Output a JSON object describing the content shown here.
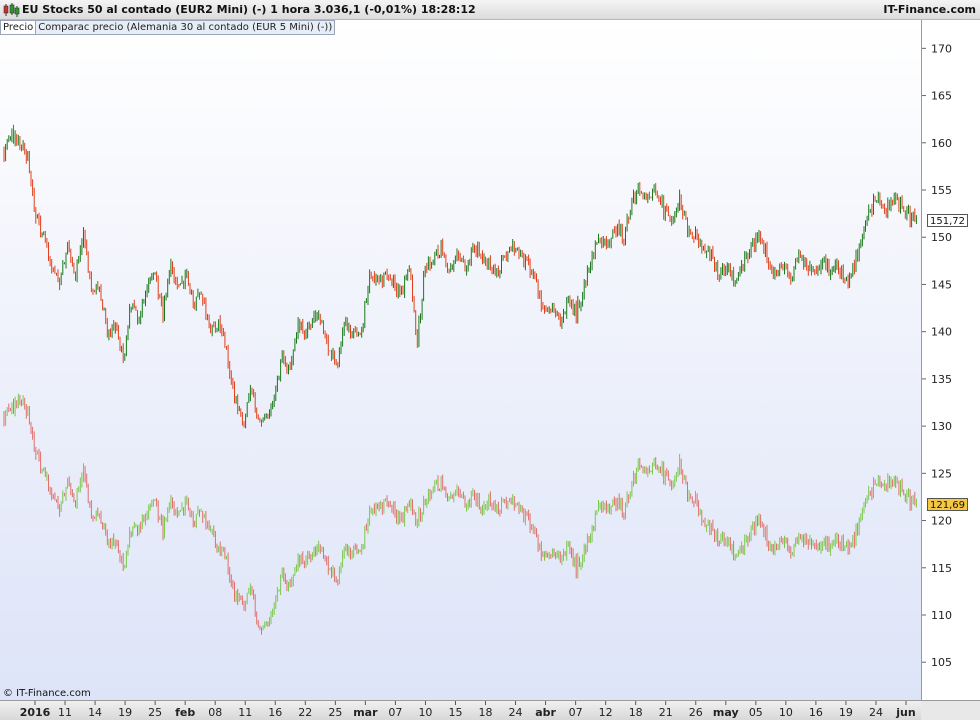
{
  "header": {
    "title": "EU Stocks 50 al contado (EUR2 Mini) (-)   1 hora   3.036,1 (-0,01%)   18:28:12",
    "brand": "IT-Finance.com"
  },
  "tabs": [
    {
      "label": "Precio"
    },
    {
      "label": "Comparac precio (Alemania 30 al contado (EUR 5 Mini) (-))"
    }
  ],
  "footer": {
    "copyright": "© IT-Finance.com"
  },
  "colors": {
    "up": "#1a7a1a",
    "down": "#e0401a",
    "compare_up": "#7cc84a",
    "compare_down": "#e0706a",
    "label_gold": "#f5c842"
  },
  "chart_data": {
    "type": "line",
    "ylim": [
      101,
      173
    ],
    "yticks": [
      105,
      110,
      115,
      120,
      125,
      130,
      135,
      140,
      145,
      150,
      155,
      160,
      165,
      170
    ],
    "xticks": [
      "2016",
      "11",
      "14",
      "19",
      "25",
      "feb",
      "08",
      "11",
      "16",
      "22",
      "25",
      "mar",
      "07",
      "10",
      "15",
      "18",
      "24",
      "abr",
      "07",
      "12",
      "18",
      "21",
      "26",
      "may",
      "05",
      "10",
      "16",
      "19",
      "24",
      "jun"
    ],
    "last_labels": [
      "151,72",
      "121,69"
    ],
    "series": [
      {
        "name": "EU Stocks 50 al contado (EUR2 Mini)",
        "points": [
          [
            0,
            159
          ],
          [
            1,
            161
          ],
          [
            2,
            160
          ],
          [
            3,
            158
          ],
          [
            4,
            152
          ],
          [
            5,
            150
          ],
          [
            6,
            147
          ],
          [
            7,
            145
          ],
          [
            8,
            149
          ],
          [
            9,
            146
          ],
          [
            10,
            150
          ],
          [
            11,
            144
          ],
          [
            12,
            145
          ],
          [
            13,
            140
          ],
          [
            14,
            141
          ],
          [
            15,
            137
          ],
          [
            16,
            143
          ],
          [
            17,
            141
          ],
          [
            18,
            145
          ],
          [
            19,
            146
          ],
          [
            20,
            142
          ],
          [
            21,
            147
          ],
          [
            22,
            145
          ],
          [
            23,
            146
          ],
          [
            24,
            143
          ],
          [
            25,
            144
          ],
          [
            26,
            140
          ],
          [
            27,
            141
          ],
          [
            28,
            138
          ],
          [
            29,
            133
          ],
          [
            30,
            130
          ],
          [
            31,
            134
          ],
          [
            32,
            130
          ],
          [
            33,
            131
          ],
          [
            34,
            133
          ],
          [
            35,
            137
          ],
          [
            36,
            136
          ],
          [
            37,
            141
          ],
          [
            38,
            140
          ],
          [
            39,
            142
          ],
          [
            40,
            141
          ],
          [
            41,
            138
          ],
          [
            42,
            137
          ],
          [
            43,
            141
          ],
          [
            44,
            140
          ],
          [
            45,
            140
          ],
          [
            46,
            146
          ],
          [
            47,
            145
          ],
          [
            48,
            146
          ],
          [
            49,
            145
          ],
          [
            50,
            144
          ],
          [
            51,
            147
          ],
          [
            52,
            139
          ],
          [
            53,
            147
          ],
          [
            54,
            148
          ],
          [
            55,
            149
          ],
          [
            56,
            146
          ],
          [
            57,
            148
          ],
          [
            58,
            147
          ],
          [
            59,
            149
          ],
          [
            60,
            148
          ],
          [
            61,
            147
          ],
          [
            62,
            146
          ],
          [
            63,
            148
          ],
          [
            64,
            149
          ],
          [
            65,
            148
          ],
          [
            66,
            147
          ],
          [
            67,
            145
          ],
          [
            68,
            142
          ],
          [
            69,
            142
          ],
          [
            70,
            141
          ],
          [
            71,
            143
          ],
          [
            72,
            142
          ],
          [
            73,
            145
          ],
          [
            74,
            148
          ],
          [
            75,
            150
          ],
          [
            76,
            149
          ],
          [
            77,
            151
          ],
          [
            78,
            150
          ],
          [
            79,
            154
          ],
          [
            80,
            155
          ],
          [
            81,
            154
          ],
          [
            82,
            155
          ],
          [
            83,
            153
          ],
          [
            84,
            152
          ],
          [
            85,
            154
          ],
          [
            86,
            151
          ],
          [
            87,
            150
          ],
          [
            88,
            149
          ],
          [
            89,
            148
          ],
          [
            90,
            146
          ],
          [
            91,
            147
          ],
          [
            92,
            145
          ],
          [
            93,
            147
          ],
          [
            94,
            149
          ],
          [
            95,
            150
          ],
          [
            96,
            148
          ],
          [
            97,
            146
          ],
          [
            98,
            147
          ],
          [
            99,
            146
          ],
          [
            100,
            148
          ],
          [
            101,
            147
          ],
          [
            102,
            146
          ],
          [
            103,
            148
          ],
          [
            104,
            146
          ],
          [
            105,
            147
          ],
          [
            106,
            145
          ],
          [
            107,
            147
          ],
          [
            108,
            150
          ],
          [
            109,
            153
          ],
          [
            110,
            154
          ],
          [
            111,
            153
          ],
          [
            112,
            154
          ],
          [
            113,
            153
          ],
          [
            114,
            152
          ],
          [
            115,
            151.72
          ]
        ]
      },
      {
        "name": "Alemania 30 al contado (EUR 5 Mini)",
        "points": [
          [
            0,
            131
          ],
          [
            1,
            132
          ],
          [
            2,
            133
          ],
          [
            3,
            131
          ],
          [
            4,
            127
          ],
          [
            5,
            125
          ],
          [
            6,
            123
          ],
          [
            7,
            121
          ],
          [
            8,
            124
          ],
          [
            9,
            122
          ],
          [
            10,
            125
          ],
          [
            11,
            120
          ],
          [
            12,
            121
          ],
          [
            13,
            118
          ],
          [
            14,
            118
          ],
          [
            15,
            115
          ],
          [
            16,
            119
          ],
          [
            17,
            119
          ],
          [
            18,
            121
          ],
          [
            19,
            122
          ],
          [
            20,
            119
          ],
          [
            21,
            122
          ],
          [
            22,
            121
          ],
          [
            23,
            122
          ],
          [
            24,
            120
          ],
          [
            25,
            121
          ],
          [
            26,
            119
          ],
          [
            27,
            117
          ],
          [
            28,
            116
          ],
          [
            29,
            112
          ],
          [
            30,
            111
          ],
          [
            31,
            113
          ],
          [
            32,
            108
          ],
          [
            33,
            109
          ],
          [
            34,
            111
          ],
          [
            35,
            114
          ],
          [
            36,
            113
          ],
          [
            37,
            116
          ],
          [
            38,
            116
          ],
          [
            39,
            117
          ],
          [
            40,
            117
          ],
          [
            41,
            115
          ],
          [
            42,
            114
          ],
          [
            43,
            117
          ],
          [
            44,
            117
          ],
          [
            45,
            117
          ],
          [
            46,
            121
          ],
          [
            47,
            121
          ],
          [
            48,
            122
          ],
          [
            49,
            121
          ],
          [
            50,
            120
          ],
          [
            51,
            122
          ],
          [
            52,
            120
          ],
          [
            53,
            122
          ],
          [
            54,
            124
          ],
          [
            55,
            124
          ],
          [
            56,
            122
          ],
          [
            57,
            123
          ],
          [
            58,
            122
          ],
          [
            59,
            123
          ],
          [
            60,
            121
          ],
          [
            61,
            122
          ],
          [
            62,
            121
          ],
          [
            63,
            122
          ],
          [
            64,
            122
          ],
          [
            65,
            121
          ],
          [
            66,
            120
          ],
          [
            67,
            118
          ],
          [
            68,
            116
          ],
          [
            69,
            116
          ],
          [
            70,
            116
          ],
          [
            71,
            117
          ],
          [
            72,
            115
          ],
          [
            73,
            117
          ],
          [
            74,
            119
          ],
          [
            75,
            122
          ],
          [
            76,
            121
          ],
          [
            77,
            122
          ],
          [
            78,
            121
          ],
          [
            79,
            124
          ],
          [
            80,
            126
          ],
          [
            81,
            125
          ],
          [
            82,
            126
          ],
          [
            83,
            125
          ],
          [
            84,
            124
          ],
          [
            85,
            126
          ],
          [
            86,
            123
          ],
          [
            87,
            122
          ],
          [
            88,
            120
          ],
          [
            89,
            119
          ],
          [
            90,
            118
          ],
          [
            91,
            118
          ],
          [
            92,
            116
          ],
          [
            93,
            117
          ],
          [
            94,
            119
          ],
          [
            95,
            120
          ],
          [
            96,
            118
          ],
          [
            97,
            117
          ],
          [
            98,
            118
          ],
          [
            99,
            117
          ],
          [
            100,
            118
          ],
          [
            101,
            118
          ],
          [
            102,
            117
          ],
          [
            103,
            118
          ],
          [
            104,
            117
          ],
          [
            105,
            118
          ],
          [
            106,
            117
          ],
          [
            107,
            118
          ],
          [
            108,
            121
          ],
          [
            109,
            123
          ],
          [
            110,
            124
          ],
          [
            111,
            124
          ],
          [
            112,
            124
          ],
          [
            113,
            123
          ],
          [
            114,
            122
          ],
          [
            115,
            121.69
          ]
        ]
      }
    ]
  }
}
